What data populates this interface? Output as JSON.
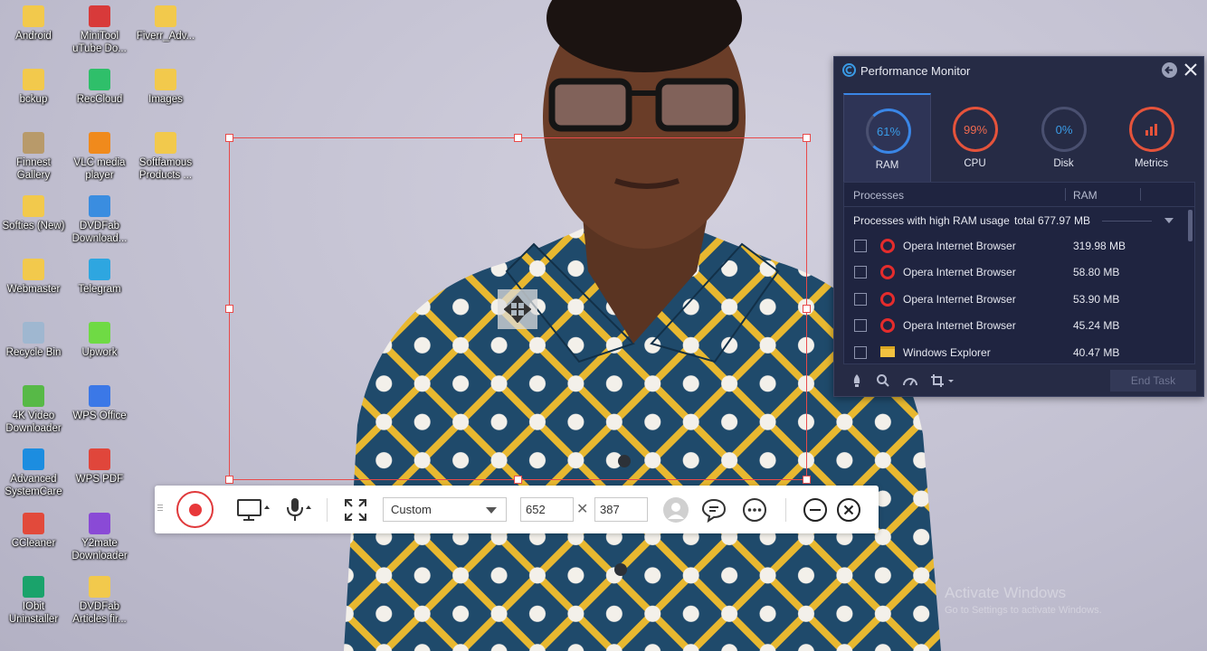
{
  "desktop": {
    "icons": [
      {
        "label": "Android",
        "color": "#f2c94c"
      },
      {
        "label": "MiniTool uTube Do...",
        "color": "#d83a3a"
      },
      {
        "label": "Fiverr_Adv...",
        "color": "#f2c94c"
      },
      {
        "label": "bckup",
        "color": "#f2c94c"
      },
      {
        "label": "RecCloud",
        "color": "#2fbf6a"
      },
      {
        "label": "Images",
        "color": "#f2c94c"
      },
      {
        "label": "Finnest Gallery",
        "color": "#b89a6a"
      },
      {
        "label": "VLC media player",
        "color": "#f08a1c"
      },
      {
        "label": "Softfamous Products ...",
        "color": "#f2c94c"
      },
      {
        "label": "Softies (New)",
        "color": "#f2c94c"
      },
      {
        "label": "DVDFab Download...",
        "color": "#3a8de0"
      },
      {
        "label": "Webmaster",
        "color": "#f2c94c"
      },
      {
        "label": "Telegram",
        "color": "#2ea6e0"
      },
      {
        "label": "Recycle Bin",
        "color": "#9fb7d0"
      },
      {
        "label": "Upwork",
        "color": "#6fda44"
      },
      {
        "label": "4K Video Downloader",
        "color": "#57b947"
      },
      {
        "label": "WPS Office",
        "color": "#3b78e7"
      },
      {
        "label": "Advanced SystemCare",
        "color": "#1c8de0"
      },
      {
        "label": "WPS PDF",
        "color": "#e0463b"
      },
      {
        "label": "CCleaner",
        "color": "#e24a3b"
      },
      {
        "label": "Y2mate Downloader",
        "color": "#8a4ad6"
      },
      {
        "label": "IObit Uninstaller",
        "color": "#1aa36b"
      },
      {
        "label": "DVDFab Articles fir...",
        "color": "#f2c94c"
      }
    ]
  },
  "watermark": {
    "title": "Activate Windows",
    "subtitle": "Go to Settings to activate Windows."
  },
  "toolbar": {
    "preset": "Custom",
    "width": "652",
    "height": "387",
    "record_color": "#e8383a"
  },
  "perf_monitor": {
    "title": "Performance Monitor",
    "tabs": [
      {
        "label": "RAM",
        "value": "61%",
        "color": "#3a86e6"
      },
      {
        "label": "CPU",
        "value": "99%",
        "color": "#e5533b"
      },
      {
        "label": "Disk",
        "value": "0%",
        "color": "#3a86e6"
      },
      {
        "label": "Metrics",
        "value": "",
        "color": "#e5533b"
      }
    ],
    "columns": {
      "processes": "Processes",
      "ram": "RAM"
    },
    "group": {
      "label": "Processes with high RAM usage",
      "total": "total 677.97 MB"
    },
    "processes": [
      {
        "name": "Opera Internet Browser",
        "ram": "319.98 MB",
        "icon": "opera"
      },
      {
        "name": "Opera Internet Browser",
        "ram": "58.80 MB",
        "icon": "opera"
      },
      {
        "name": "Opera Internet Browser",
        "ram": "53.90 MB",
        "icon": "opera"
      },
      {
        "name": "Opera Internet Browser",
        "ram": "45.24 MB",
        "icon": "opera"
      },
      {
        "name": "Windows Explorer",
        "ram": "40.47 MB",
        "icon": "folder"
      }
    ],
    "end_task": "End Task"
  }
}
